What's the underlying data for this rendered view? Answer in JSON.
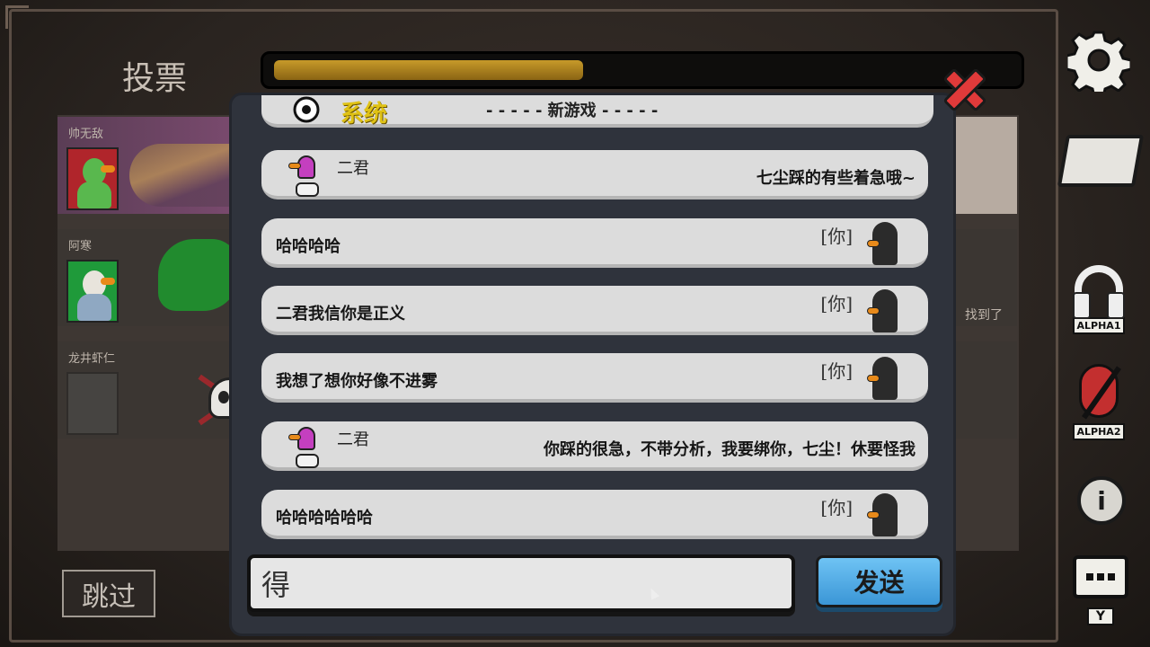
{
  "vote_title": "投票",
  "progress": {
    "fraction": 0.42,
    "color": "#c79a2a"
  },
  "players": [
    {
      "name": "帅无敌",
      "avatar_color": "#b0252b",
      "status": "alive"
    },
    {
      "name": "阿寒",
      "avatar_color": "#1f9a3a",
      "status": "alive"
    },
    {
      "name": "龙井虾仁",
      "status": "dead"
    }
  ],
  "right_column_text": "找到了",
  "skip_label": "跳过",
  "chat": {
    "system": {
      "label": "系统",
      "text": "- - - - - 新游戏 - - - - -"
    },
    "messages": [
      {
        "sender": "二君",
        "text": "七尘踩的有些着急哦~",
        "self": false
      },
      {
        "you_tag": "[你]",
        "text": "哈哈哈哈",
        "self": true
      },
      {
        "you_tag": "[你]",
        "text": "二君我信你是正义",
        "self": true
      },
      {
        "you_tag": "[你]",
        "text": "我想了想你好像不进雾",
        "self": true
      },
      {
        "sender": "二君",
        "text": "你踩的很急，不带分析，我要绑你，七尘！休要怪我",
        "self": false
      },
      {
        "you_tag": "[你]",
        "text": "哈哈哈哈哈哈",
        "self": true
      }
    ],
    "input_value": "得",
    "send_label": "发送"
  },
  "sidebar": {
    "settings_icon": "gear-icon",
    "map_icon": "map-icon",
    "voice1_label": "ALPHA1",
    "voice2_label": "ALPHA2",
    "info_icon": "info-icon",
    "chat_key": "Y"
  },
  "colors": {
    "send_button": "#3b96d6",
    "close": "#e03a3a",
    "system_label": "#e0c214"
  }
}
